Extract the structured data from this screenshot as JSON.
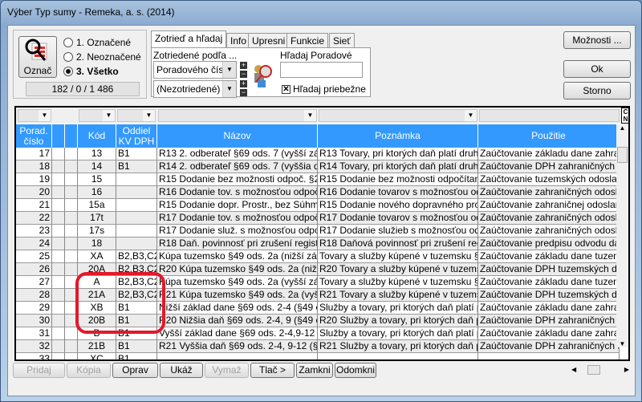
{
  "window": {
    "title": "Výber Typ sumy - Remeka, a. s. (2014)"
  },
  "mark": {
    "button_label": "Označ",
    "options": [
      "1. Označené",
      "2. Neoznačené",
      "3. Všetko"
    ],
    "selected": 2,
    "counts": "182 / 0 / 1 486"
  },
  "tabs": [
    "Zotrieď a hľadaj",
    "Info",
    "Upresni",
    "Funkcie",
    "Sieť"
  ],
  "sort": {
    "label": "Zotriedené podľa ...",
    "primary": "Poradového čísla",
    "secondary": "(Nezotriedené)"
  },
  "search": {
    "label": "Hľadaj Poradové číslo",
    "value": "",
    "incremental_label": "Hľadaj priebežne",
    "incremental_checked": true
  },
  "side_buttons": {
    "options": "Možnosti ...",
    "ok": "Ok",
    "cancel": "Storno"
  },
  "grid": {
    "corner": [
      "C",
      "N"
    ],
    "columns": [
      "Porad. číslo",
      "",
      "",
      "Kód",
      "Oddiel KV DPH",
      "Názov",
      "Poznámka",
      "Použitie"
    ],
    "rows": [
      [
        "17",
        "13",
        "B1",
        "R13 2. odberateľ §69 ods. 7 (vyšší základ",
        "R13 Tovary, pri ktorých daň platí druhý o",
        "Zaúčtovanie základu dane zahraničn"
      ],
      [
        "18",
        "14",
        "B1",
        "R14 2. odberateľ §69 ods. 7 (vyššia daň)",
        "R14 Tovary, pri ktorých daň platí druhý o",
        "Zaúčtovanie DPH zahraničných došl"
      ],
      [
        "19",
        "15",
        "",
        "R15 Dodanie bez možnosti odpoč. §28-4;",
        "R15 Dodanie bez možnosti odpočítania d",
        "Zaúčtovanie tuzemských odoslaných"
      ],
      [
        "20",
        "16",
        "",
        "R16 Dodanie tov. s možnosťou odpoč. §4",
        "R16 Dodanie tovarov s možnosťou odpoč",
        "Zaúčtovanie zahraničných odoslanýc"
      ],
      [
        "21",
        "15a",
        "",
        "R15 Dodanie dopr. Prostr., bez Súhmného",
        "R15 Dodanie nového dopravného prostri",
        "Zaúčtovanie zahraničnej odoslanej fa"
      ],
      [
        "22",
        "17t",
        "",
        "R17 Dodanie tov. s možnosťou odpoč. §4",
        "R17 Dodanie tovarov s možnosťou odpoč",
        "Zaúčtovanie zahraničných odoslanýc"
      ],
      [
        "23",
        "17s",
        "",
        "R17 Dodanie služ. s možnosťou odpoč. §",
        "R17 Dodanie služieb s možnosťou odpoč",
        "Zaúčtovanie zahraničných odoslanýc"
      ],
      [
        "24",
        "18",
        "",
        "R18 Daň. povinnosť pri zrušení registrácie",
        "R18 Daňová povinnosť pri zrušení registr",
        "Zaúčtovanie predpisu odvodu dane p"
      ],
      [
        "25",
        "XA",
        "B2,B3,C2",
        "Kúpa tuzemsko §49 ods. 2a (nižší základ",
        "Tovary a služby kúpené v tuzemsku §49",
        "Zaúčtovanie základu dane tuzemský"
      ],
      [
        "26",
        "20A",
        "B2,B3,C2",
        "R20 Kúpa tuzemsko §49 ods. 2a (nižšia d",
        "R20 Tovary a služby kúpené v tuzemsku",
        "Zaúčtovanie DPH tuzemských došlý"
      ],
      [
        "27",
        "A",
        "B2,B3,C2",
        "Kúpa tuzemsko §49 ods. 2a (vyšší základ",
        "Tovary a služby kúpené v tuzemsku §49",
        "Zaúčtovanie základu dane tuzemský"
      ],
      [
        "28",
        "21A",
        "B2,B3,C2",
        "R21 Kúpa tuzemsko §49 ods. 2a (vyššia d",
        "R21 Tovary a služby kúpené v tuzemsku",
        "Zaúčtovanie  DPH tuzemských došlý"
      ],
      [
        "29",
        "XB",
        "B1",
        "Nižší základ dane §69 ods. 2-4 (§49 ods.",
        "Služby a tovary, pri ktorých daň platí príje",
        "Zaúčtovanie základu dane zahraničn"
      ],
      [
        "30",
        "20B",
        "B1",
        "R20 Nižšia daň §69 ods. 2-4, 9 (§49 ods.",
        "R20 Služby a tovary, pri ktorých daň platí",
        "Zaúčtovanie DPH zahraničných došl"
      ],
      [
        "31",
        "B",
        "B1",
        "Vyšší základ dane §69 ods. 2-4,9-12 (§49",
        "Služby a tovary, pri ktorých daň platí príje",
        "Zaúčtovanie základu dane zahraničn"
      ],
      [
        "32",
        "21B",
        "B1",
        "R21 Vyššia daň §69 ods. 2-4, 9-12 (§49 d",
        "R21 Služby a tovary, pri ktorých daň platí",
        "Zaúčtovanie DPH zahraničných došl"
      ],
      [
        "33",
        "XC",
        "B1",
        "",
        "",
        ""
      ]
    ]
  },
  "bottom_buttons": [
    {
      "label": "Pridaj",
      "enabled": false
    },
    {
      "label": "Kópia",
      "enabled": false
    },
    {
      "label": "Oprav",
      "enabled": true
    },
    {
      "label": "Ukáž",
      "enabled": true
    },
    {
      "label": "Vymaž",
      "enabled": false
    },
    {
      "label": "Tlač >",
      "enabled": true
    },
    {
      "label": "Zamkni",
      "enabled": true
    },
    {
      "label": "Odomkni",
      "enabled": true
    }
  ],
  "colors": {
    "header": "#3399ff",
    "highlight": "#e3192a"
  }
}
